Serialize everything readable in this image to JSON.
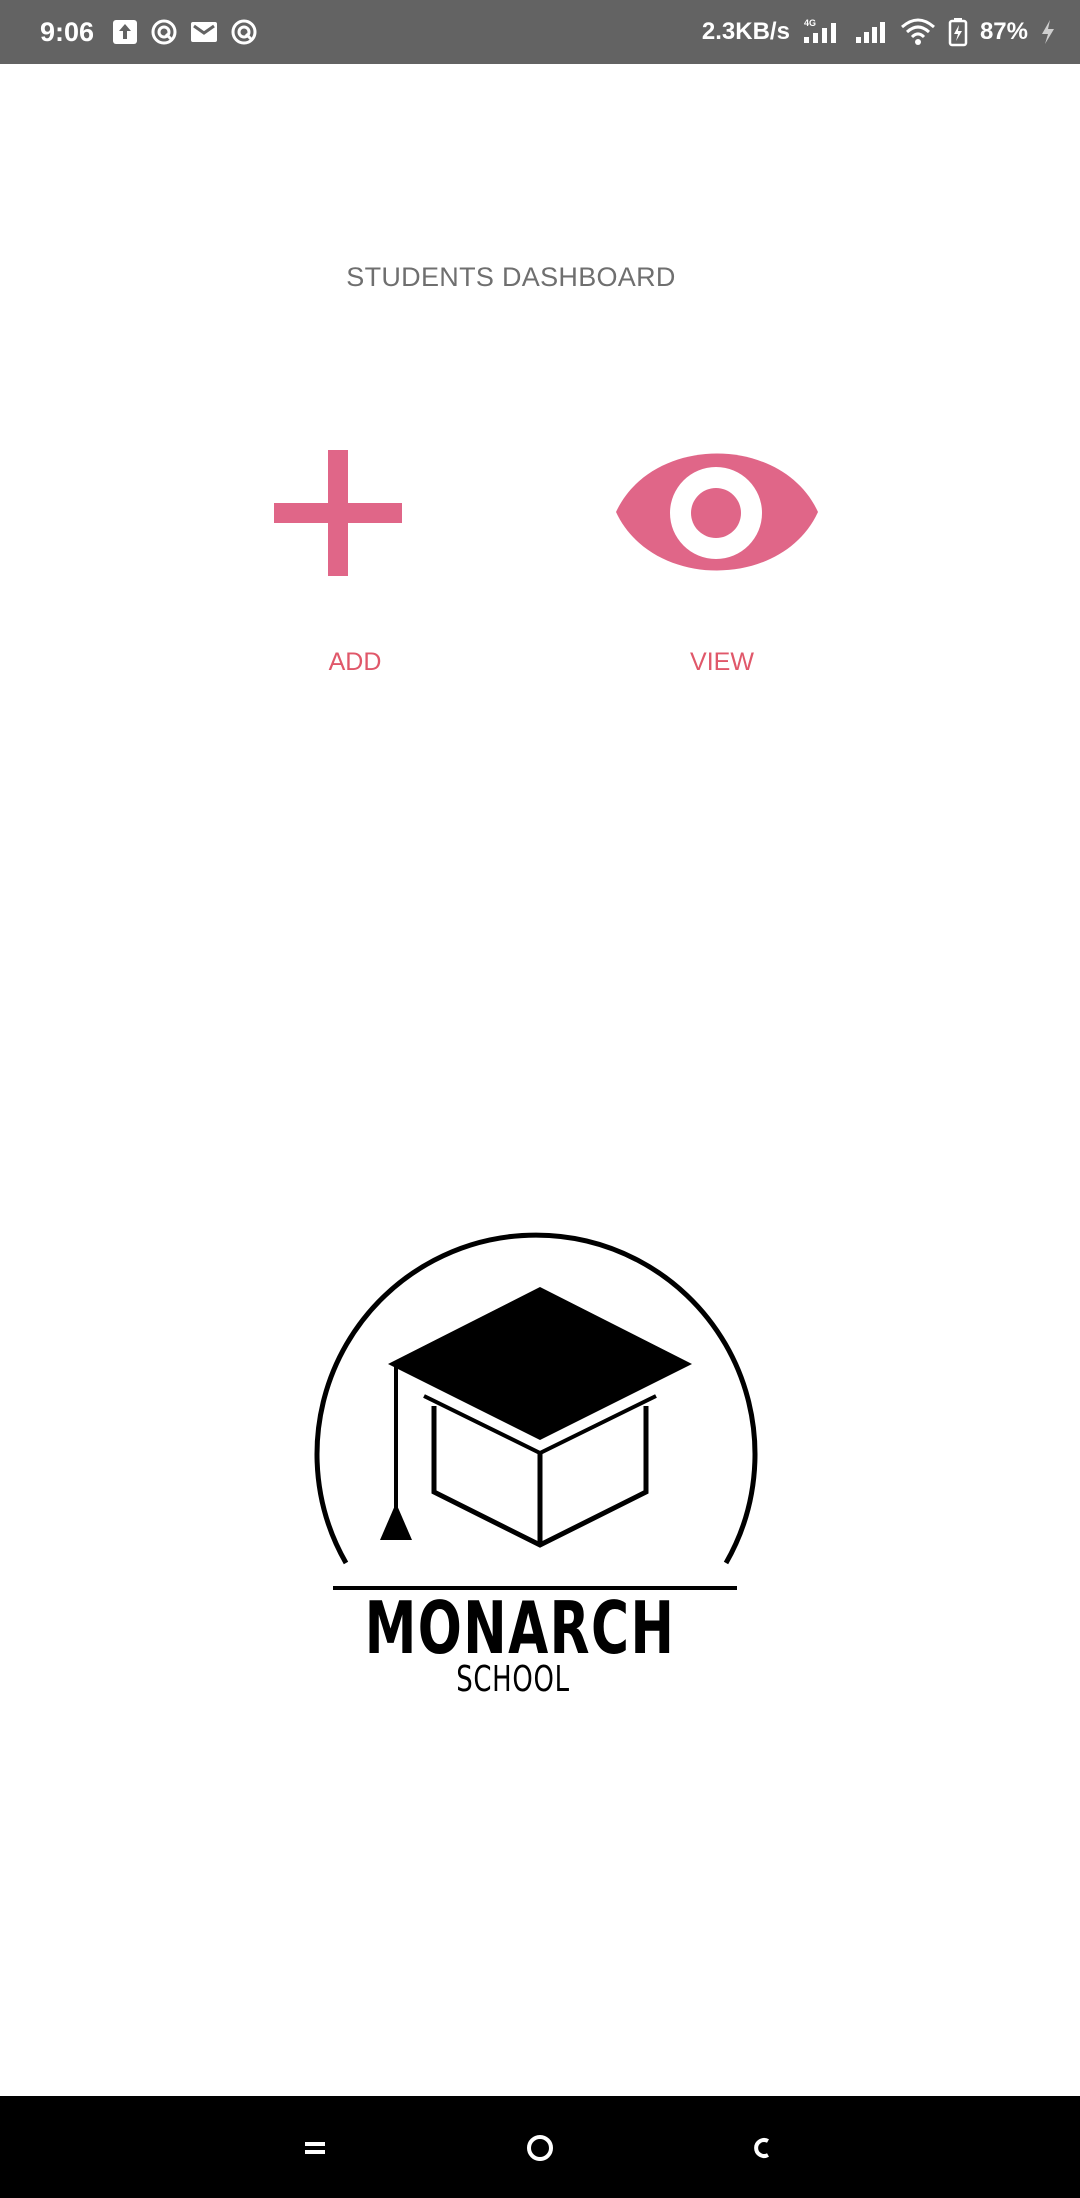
{
  "status_bar": {
    "time": "9:06",
    "left_icons": [
      "upload-icon",
      "notification-app-icon",
      "gmail-icon",
      "notification-app-icon"
    ],
    "network_speed": "2.3KB/s",
    "right_icons": [
      "4g-signal-icon",
      "signal-icon",
      "wifi-icon",
      "battery-icon",
      "charging-icon"
    ],
    "battery": "87%"
  },
  "page": {
    "title": "STUDENTS DASHBOARD"
  },
  "actions": {
    "add_label": "ADD",
    "view_label": "VIEW",
    "accent_color": "#e06688",
    "label_color": "#e0586a"
  },
  "logo": {
    "name": "MONARCH",
    "subtitle": "SCHOOL",
    "icon": "graduation-cap-icon"
  },
  "nav_bar": {
    "buttons": [
      "menu-icon",
      "home-icon",
      "back-icon"
    ]
  }
}
